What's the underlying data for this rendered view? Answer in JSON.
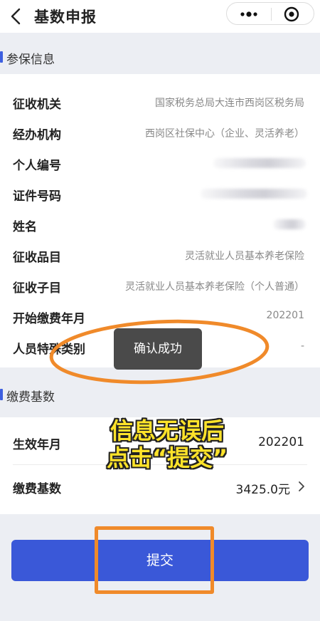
{
  "header": {
    "title": "基数申报",
    "icons": {
      "back": "chevron-left-icon",
      "more": "more-icon",
      "close": "target-icon"
    }
  },
  "insurance_info": {
    "section_title": "参保信息",
    "rows": [
      {
        "label": "征收机关",
        "value": "国家税务总局大连市西岗区税务局"
      },
      {
        "label": "经办机构",
        "value": "西岗区社保中心（企业、灵活养老）"
      },
      {
        "label": "个人编号",
        "value": "",
        "redacted": true
      },
      {
        "label": "证件号码",
        "value": "",
        "redacted": true
      },
      {
        "label": "姓名",
        "value": "",
        "redacted": true
      },
      {
        "label": "征收品目",
        "value": "灵活就业人员基本养老保险"
      },
      {
        "label": "征收子目",
        "value": "灵活就业人员基本养老保险（个人普通）"
      },
      {
        "label": "开始缴费年月",
        "value": "202201"
      },
      {
        "label": "人员特殊类别",
        "value": "-"
      }
    ]
  },
  "payment_base": {
    "section_title": "缴费基数",
    "rows": [
      {
        "label": "生效年月",
        "value": "202201"
      },
      {
        "label": "缴费基数",
        "value": "3425.0元"
      }
    ]
  },
  "toast": {
    "text": "确认成功"
  },
  "annotation": {
    "line1": "信息无误后",
    "line2": "点击“提交”",
    "color": "#ffe32a",
    "highlight_color": "#f08a2a"
  },
  "submit": {
    "label": "提交",
    "color": "#3a58d8"
  }
}
